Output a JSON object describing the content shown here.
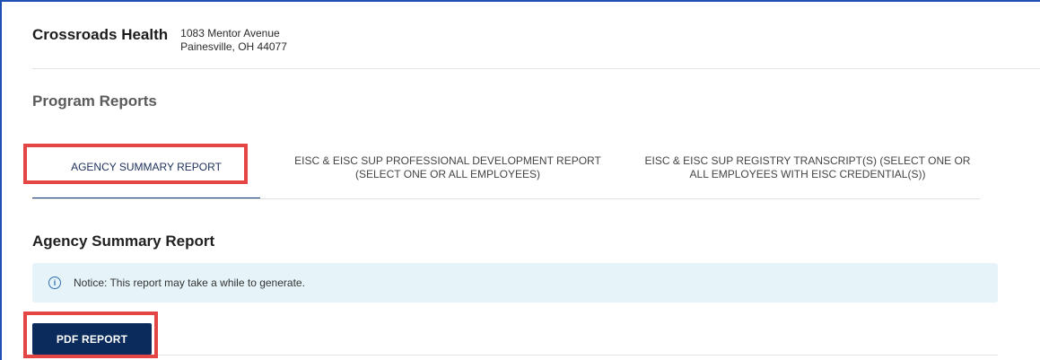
{
  "organization": {
    "name": "Crossroads Health",
    "address_line1": "1083 Mentor Avenue",
    "address_line2": "Painesville, OH 44077"
  },
  "section_title": "Program Reports",
  "tabs": [
    {
      "label": "AGENCY SUMMARY REPORT",
      "active": true
    },
    {
      "label": "EISC & EISC SUP PROFESSIONAL DEVELOPMENT REPORT (SELECT ONE OR ALL EMPLOYEES)",
      "active": false
    },
    {
      "label": "EISC & EISC SUP REGISTRY TRANSCRIPT(S) (SELECT ONE OR ALL EMPLOYEES WITH EISC CREDENTIAL(S))",
      "active": false
    }
  ],
  "report": {
    "title": "Agency Summary Report",
    "notice_icon": "info-icon",
    "notice_text": "Notice: This report may take a while to generate.",
    "pdf_button_label": "PDF REPORT"
  },
  "colors": {
    "frame_border": "#1f4fb3",
    "active_tab_underline": "#1a3a78",
    "highlight": "#e44545",
    "notice_background": "#e6f4fa",
    "button_background": "#0b2b5c"
  }
}
